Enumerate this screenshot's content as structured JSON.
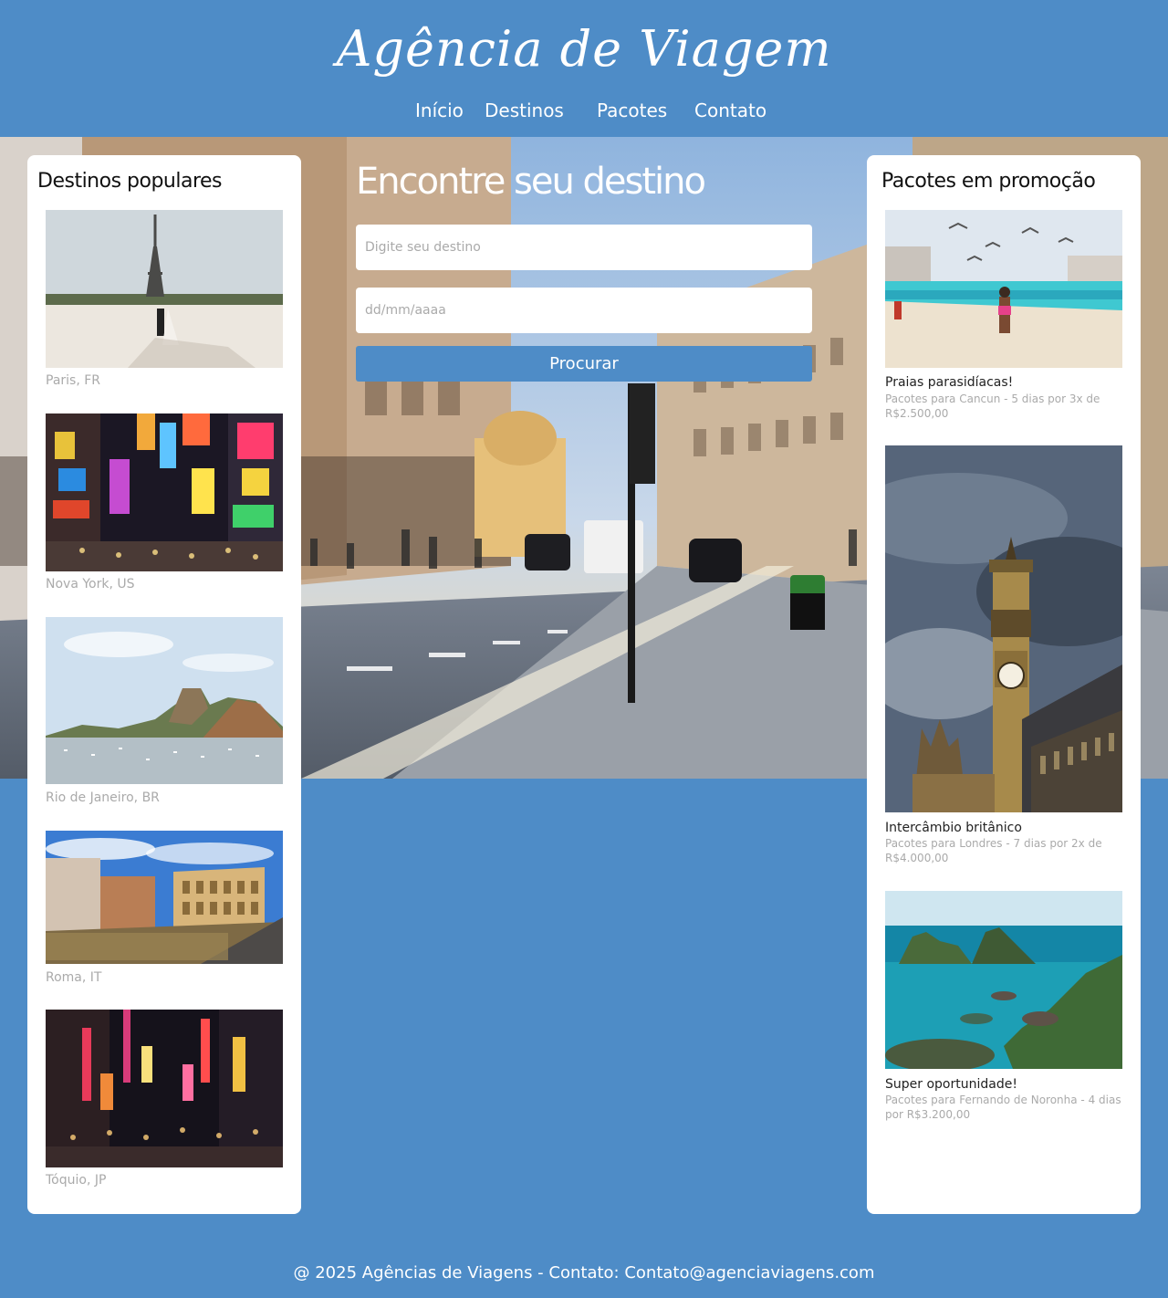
{
  "header": {
    "title": "Agência de Viagem",
    "nav": [
      {
        "label": "Início"
      },
      {
        "label": "Destinos"
      },
      {
        "label": "Pacotes"
      },
      {
        "label": "Contato"
      }
    ]
  },
  "search": {
    "title": "Encontre seu destino",
    "destination_placeholder": "Digite seu destino",
    "date_placeholder": "dd/mm/aaaa",
    "button_label": "Procurar"
  },
  "popular": {
    "title": "Destinos populares",
    "items": [
      {
        "caption": "Paris, FR"
      },
      {
        "caption": "Nova York, US"
      },
      {
        "caption": "Rio de Janeiro, BR"
      },
      {
        "caption": "Roma, IT"
      },
      {
        "caption": "Tóquio, JP"
      }
    ]
  },
  "promos": {
    "title": "Pacotes em promoção",
    "items": [
      {
        "title": "Praias parasidíacas!",
        "desc": "Pacotes para Cancun - 5 dias por 3x de R$2.500,00"
      },
      {
        "title": "Intercâmbio britânico",
        "desc": "Pacotes para Londres - 7 dias por 2x de R$4.000,00"
      },
      {
        "title": "Super oportunidade!",
        "desc": "Pacotes para Fernando de Noronha - 4 dias por R$3.200,00"
      }
    ]
  },
  "footer": {
    "text": "@ 2025 Agências de Viagens - Contato: Contato@agenciaviagens.com"
  },
  "colors": {
    "primary": "#4e8cc7",
    "panel": "#ffffff",
    "caption": "#aaaaaa"
  }
}
